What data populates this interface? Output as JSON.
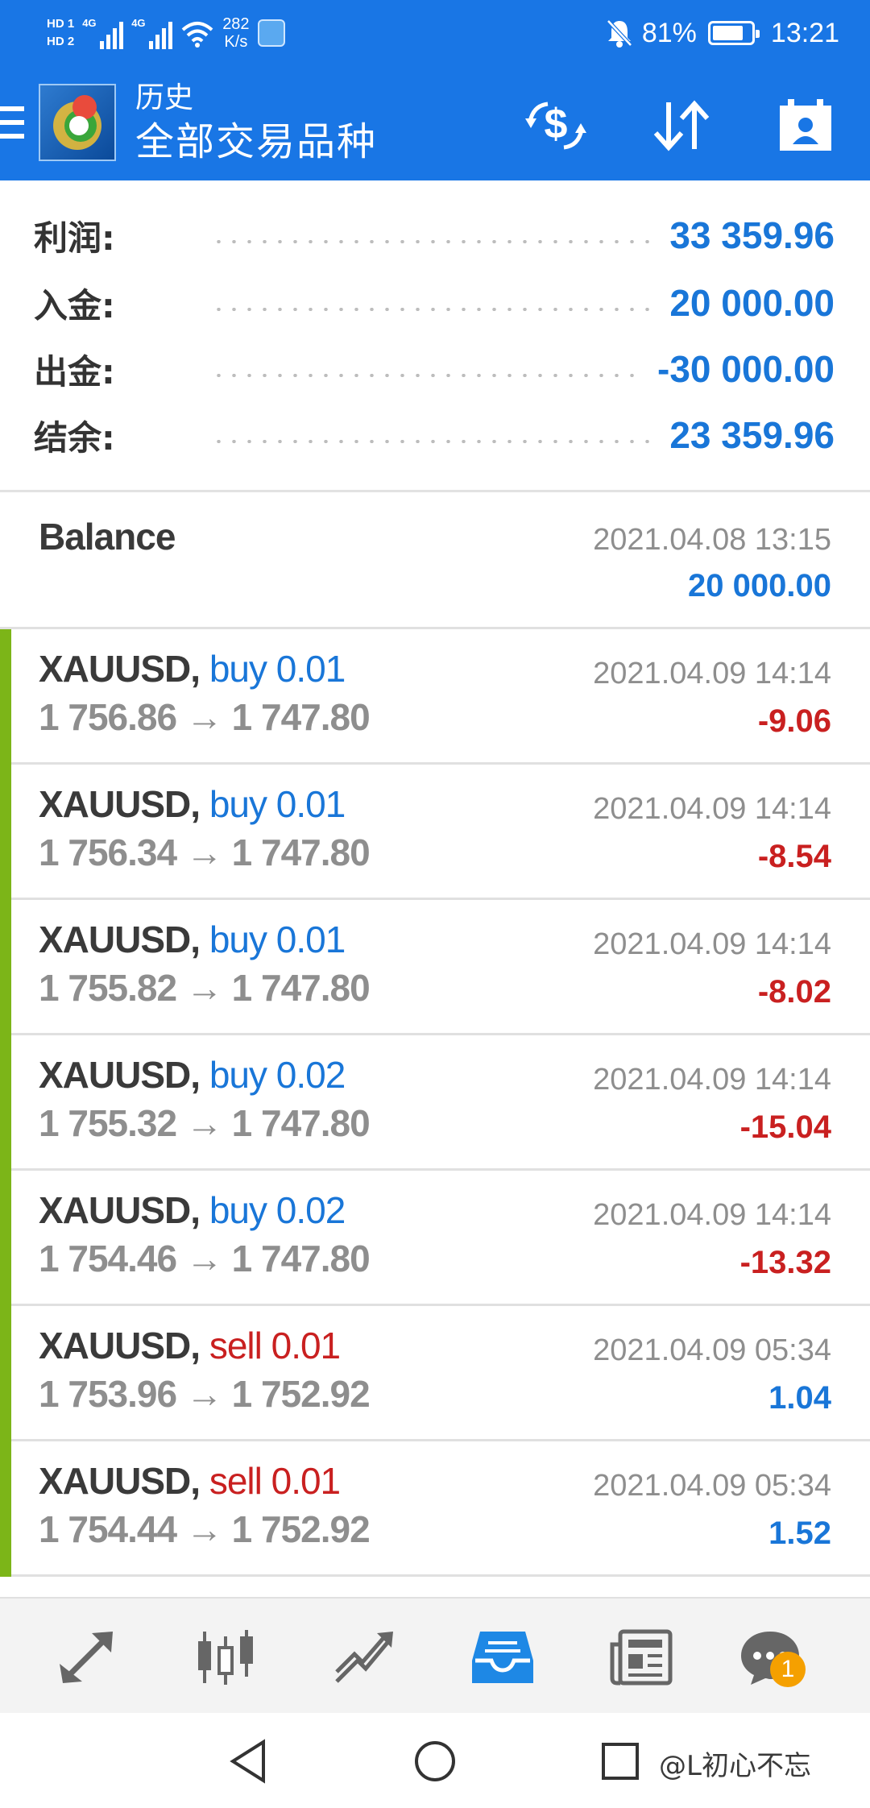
{
  "status_bar": {
    "hd1": "HD 1",
    "hd2": "HD 2",
    "net1": "4G",
    "net2": "4G",
    "speed_value": "282",
    "speed_unit": "K/s",
    "battery": "81%",
    "battery_level": 0.81,
    "time": "13:21"
  },
  "app_bar": {
    "subtitle": "历史",
    "title": "全部交易品种",
    "icons": [
      "menu-icon",
      "app-logo",
      "dollar-sync-icon",
      "sort-icon",
      "calendar-user-icon"
    ]
  },
  "summary": {
    "profit_label": "利润:",
    "profit_value": "33 359.96",
    "deposit_label": "入金:",
    "deposit_value": "20 000.00",
    "withdrawal_label": "出金:",
    "withdrawal_value": "-30 000.00",
    "balance_label": "结余:",
    "balance_value": "23 359.96"
  },
  "balance_entry": {
    "label": "Balance",
    "time": "2021.04.08 13:15",
    "amount": "20 000.00"
  },
  "trades": [
    {
      "symbol": "XAUUSD,",
      "side": "buy 0.01",
      "prices": "1 756.86 → 1 747.80",
      "time": "2021.04.09 14:14",
      "profit": "-9.06"
    },
    {
      "symbol": "XAUUSD,",
      "side": "buy 0.01",
      "prices": "1 756.34 → 1 747.80",
      "time": "2021.04.09 14:14",
      "profit": "-8.54"
    },
    {
      "symbol": "XAUUSD,",
      "side": "buy 0.01",
      "prices": "1 755.82 → 1 747.80",
      "time": "2021.04.09 14:14",
      "profit": "-8.02"
    },
    {
      "symbol": "XAUUSD,",
      "side": "buy 0.02",
      "prices": "1 755.32 → 1 747.80",
      "time": "2021.04.09 14:14",
      "profit": "-15.04"
    },
    {
      "symbol": "XAUUSD,",
      "side": "buy 0.02",
      "prices": "1 754.46 → 1 747.80",
      "time": "2021.04.09 14:14",
      "profit": "-13.32"
    },
    {
      "symbol": "XAUUSD,",
      "side": "sell 0.01",
      "prices": "1 753.96 → 1 752.92",
      "time": "2021.04.09 05:34",
      "profit": "1.04"
    },
    {
      "symbol": "XAUUSD,",
      "side": "sell 0.01",
      "prices": "1 754.44 → 1 752.92",
      "time": "2021.04.09 05:34",
      "profit": "1.52"
    }
  ],
  "bottom_nav": {
    "items": [
      "quotes-icon",
      "chart-icon",
      "trade-icon",
      "history-icon",
      "news-icon",
      "chat-icon"
    ],
    "active": "history-icon",
    "chat_badge": "1"
  },
  "system_nav": {
    "items": [
      "back-icon",
      "home-icon",
      "recents-icon"
    ],
    "watermark": "@L初心不忘"
  },
  "colors": {
    "primary": "#1976e5",
    "value_blue": "#1976d8",
    "loss_red": "#c92020",
    "accent_green": "#7cb518",
    "muted_gray": "#8e8e8e"
  }
}
